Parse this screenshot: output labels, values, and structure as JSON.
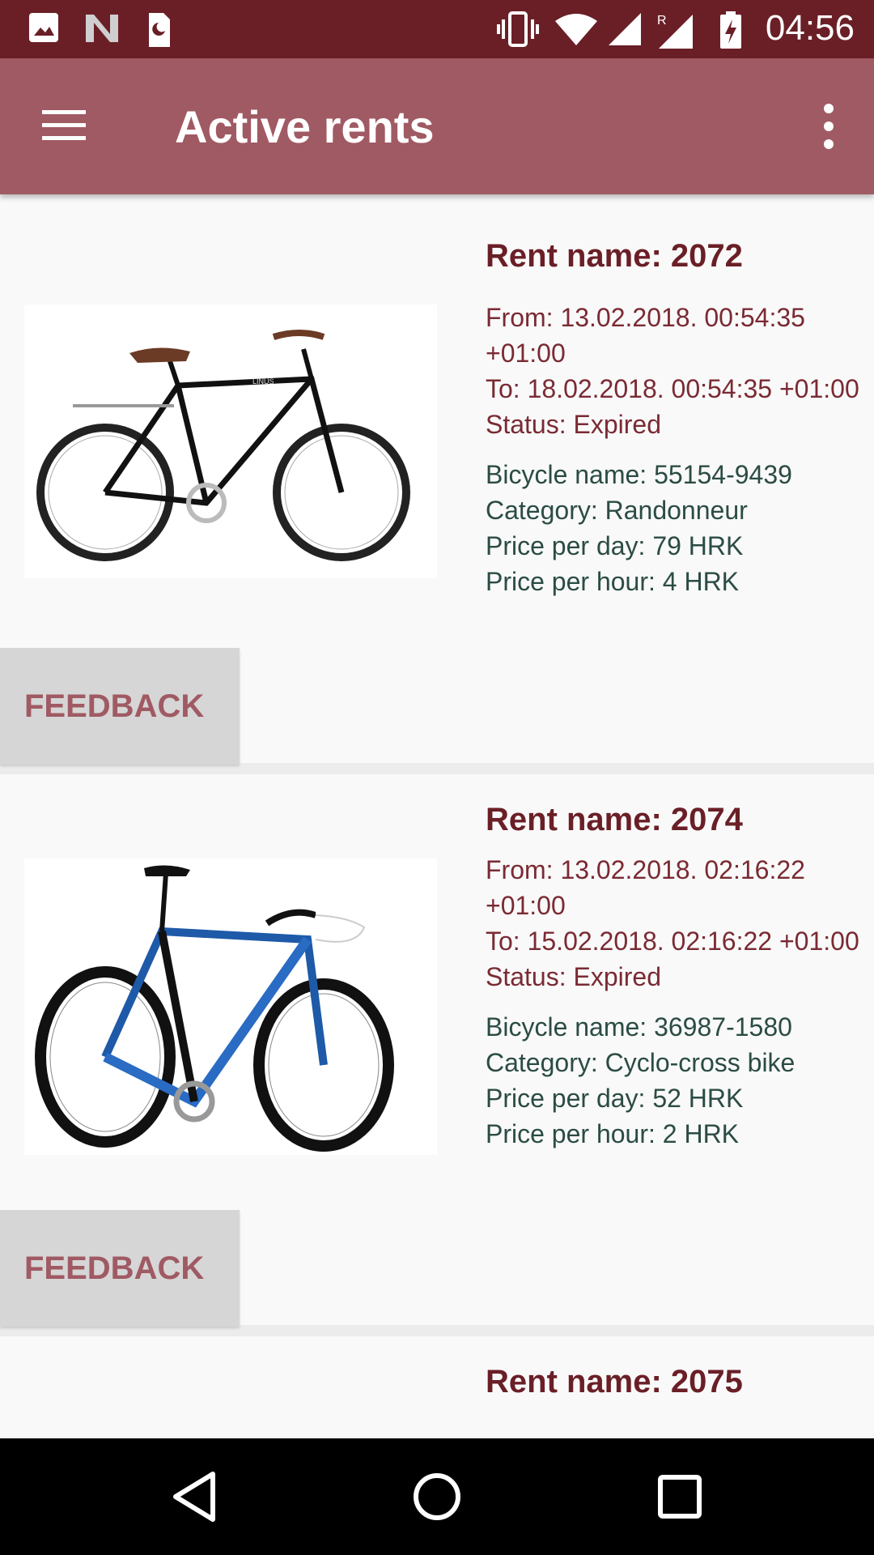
{
  "status_bar": {
    "time": "04:56",
    "left_icons": [
      "image-icon",
      "n-icon",
      "sim-icon"
    ],
    "right_icons": [
      "vibrate-icon",
      "wifi-icon",
      "signal-icon",
      "roaming-signal-icon",
      "battery-charging-icon"
    ]
  },
  "app_bar": {
    "title": "Active rents",
    "menu_icon": "hamburger-menu-icon",
    "overflow_icon": "more-vert-icon"
  },
  "rents": [
    {
      "rent_name": "Rent name: 2072",
      "from": "From: 13.02.2018. 00:54:35 +01:00",
      "to": "To: 18.02.2018. 00:54:35 +01:00",
      "status": "Status: Expired",
      "bicycle_name": "Bicycle name: 55154-9439",
      "category": "Category: Randonneur",
      "price_per_day": "Price per day: 79 HRK",
      "price_per_hour": "Price per hour: 4 HRK",
      "feedback_label": "FEEDBACK"
    },
    {
      "rent_name": "Rent name: 2074",
      "from": "From: 13.02.2018. 02:16:22 +01:00",
      "to": "To: 15.02.2018. 02:16:22 +01:00",
      "status": "Status: Expired",
      "bicycle_name": "Bicycle name: 36987-1580",
      "category": "Category: Cyclo-cross bike",
      "price_per_day": "Price per day: 52 HRK",
      "price_per_hour": "Price per hour: 2 HRK",
      "feedback_label": "FEEDBACK"
    },
    {
      "rent_name": "Rent name: 2075"
    }
  ],
  "nav_bar": {
    "back_icon": "back-triangle-icon",
    "home_icon": "home-circle-icon",
    "recents_icon": "recents-square-icon"
  }
}
